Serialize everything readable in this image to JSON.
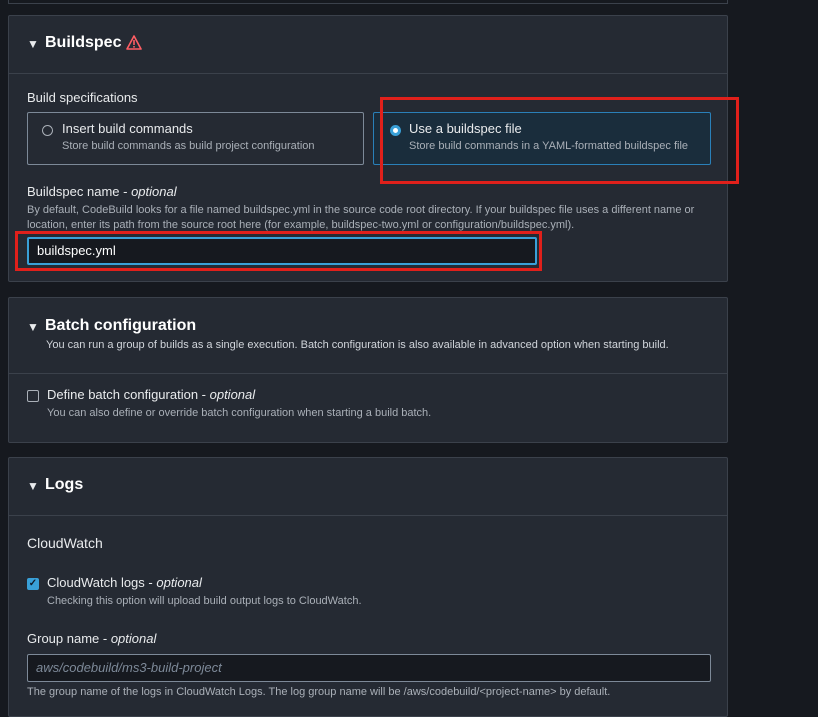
{
  "buildspec": {
    "title": "Buildspec",
    "warning_icon": "warning-icon",
    "build_specs_label": "Build specifications",
    "option_insert": {
      "label": "Insert build commands",
      "desc": "Store build commands as build project configuration"
    },
    "option_file": {
      "label": "Use a buildspec file",
      "desc": "Store build commands in a YAML-formatted buildspec file"
    },
    "name_label": "Buildspec name",
    "name_optional": "optional",
    "name_desc_1": "By default, CodeBuild looks for a file named buildspec.yml in the source code root directory. If your buildspec file uses a different name or",
    "name_desc_2": "location, enter its path from the source root here (for example, buildspec-two.yml or configuration/buildspec.yml).",
    "name_value": "buildspec.yml"
  },
  "batch": {
    "title": "Batch configuration",
    "subtitle": "You can run a group of builds as a single execution. Batch configuration is also available in advanced option when starting build.",
    "define_label": "Define batch configuration",
    "define_optional": "optional",
    "define_desc": "You can also define or override batch configuration when starting a build batch.",
    "define_checked": false
  },
  "logs": {
    "title": "Logs",
    "cloudwatch_heading": "CloudWatch",
    "cw_logs_label": "CloudWatch logs",
    "cw_logs_optional": "optional",
    "cw_logs_desc": "Checking this option will upload build output logs to CloudWatch.",
    "cw_logs_checked": true,
    "group_label": "Group name",
    "group_optional": "optional",
    "group_placeholder": "aws/codebuild/ms3-build-project",
    "group_desc": "The group name of the logs in CloudWatch Logs. The log group name will be /aws/codebuild/<project-name> by default."
  },
  "colors": {
    "accent": "#39a0d8",
    "highlight": "#e0201b",
    "warning": "#ff5d64"
  }
}
